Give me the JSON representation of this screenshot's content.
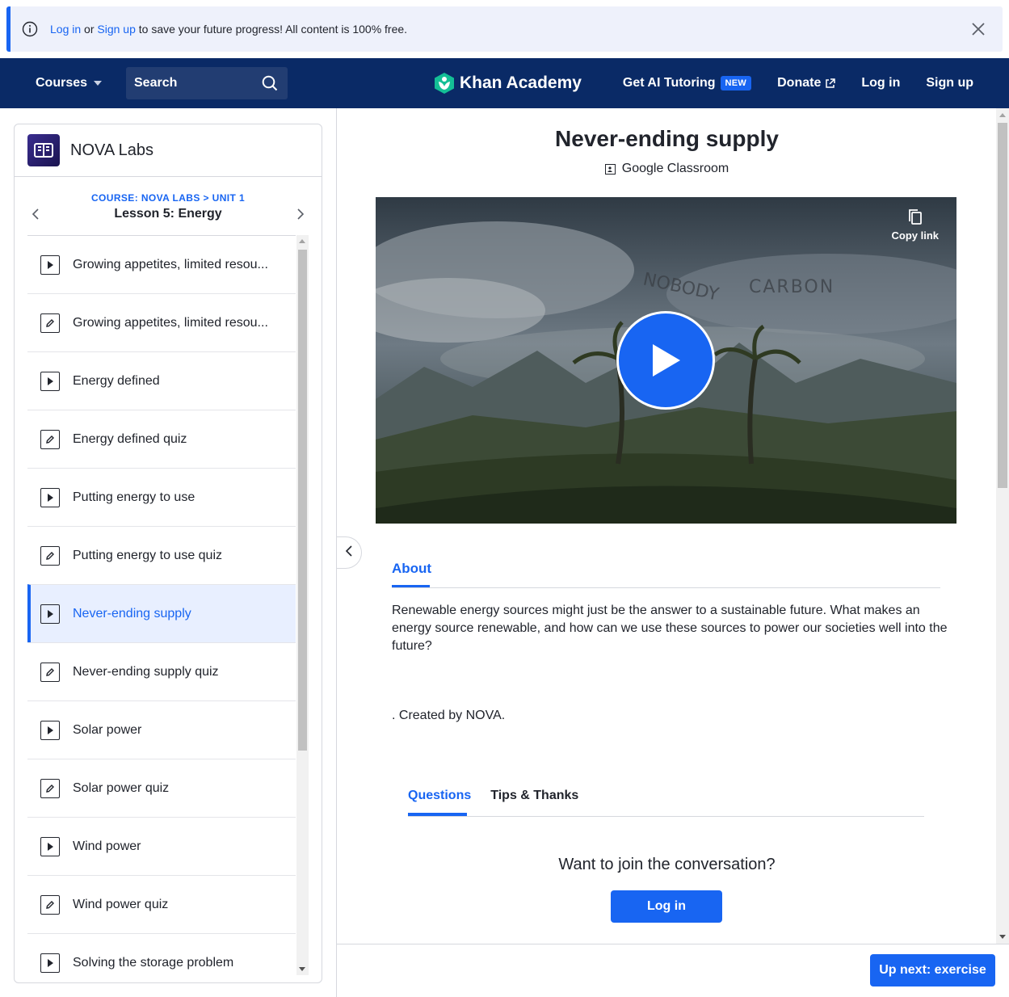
{
  "banner": {
    "login_link": "Log in",
    "or_text": " or ",
    "signup_link": "Sign up",
    "message": " to save your future progress! All content is 100% free."
  },
  "navbar": {
    "courses_label": "Courses",
    "search_placeholder": "Search",
    "logo_text": "Khan Academy",
    "ai_tutoring_label": "Get AI Tutoring",
    "new_badge": "NEW",
    "donate_label": "Donate",
    "login_label": "Log in",
    "signup_label": "Sign up"
  },
  "sidebar": {
    "course_title": "NOVA Labs",
    "breadcrumb": "COURSE: NOVA LABS > UNIT 1",
    "lesson_title": "Lesson 5: Energy",
    "items": [
      {
        "label": "Growing appetites, limited resou...",
        "kind": "video"
      },
      {
        "label": "Growing appetites, limited resou...",
        "kind": "exercise"
      },
      {
        "label": "Energy defined",
        "kind": "video"
      },
      {
        "label": "Energy defined quiz",
        "kind": "exercise"
      },
      {
        "label": "Putting energy to use",
        "kind": "video"
      },
      {
        "label": "Putting energy to use quiz",
        "kind": "exercise"
      },
      {
        "label": "Never-ending supply",
        "kind": "video",
        "active": true
      },
      {
        "label": "Never-ending supply quiz",
        "kind": "exercise"
      },
      {
        "label": "Solar power",
        "kind": "video"
      },
      {
        "label": "Solar power quiz",
        "kind": "exercise"
      },
      {
        "label": "Wind power",
        "kind": "video"
      },
      {
        "label": "Wind power quiz",
        "kind": "exercise"
      },
      {
        "label": "Solving the storage problem",
        "kind": "video"
      }
    ]
  },
  "main": {
    "title": "Never-ending supply",
    "google_classroom": "Google Classroom",
    "video": {
      "copy_link": "Copy link",
      "overlay_text_1": "NOBODY",
      "overlay_text_2": "CARBON"
    },
    "about_tab": "About",
    "about_text": "Renewable energy sources might just be the answer to a sustainable future. What makes an energy source renewable, and how can we use these sources to power our societies well into the future?",
    "created_by": ". Created by NOVA.",
    "tabs": [
      "Questions",
      "Tips & Thanks"
    ],
    "join_heading": "Want to join the conversation?",
    "login_button": "Log in"
  },
  "footer": {
    "up_next_button": "Up next: exercise"
  },
  "colors": {
    "brand_blue": "#1865f2",
    "navbar_bg": "#0a2a66",
    "khan_green": "#14bf96"
  }
}
